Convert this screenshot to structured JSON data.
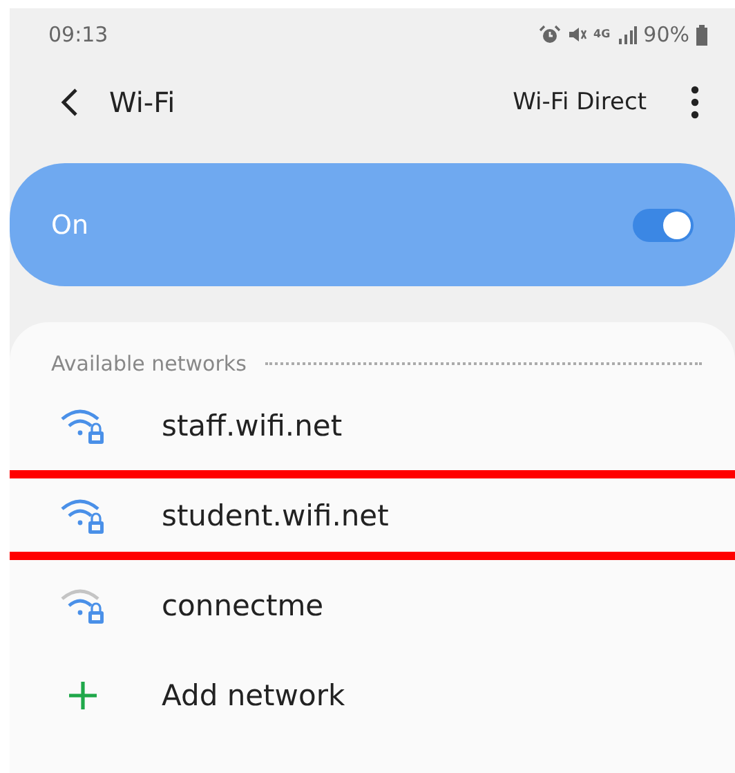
{
  "status_bar": {
    "time": "09:13",
    "network_type": "4G",
    "battery": "90%"
  },
  "header": {
    "title": "Wi-Fi",
    "action": "Wi-Fi Direct"
  },
  "master_switch": {
    "label": "On",
    "on": true
  },
  "section": {
    "title": "Available networks"
  },
  "items": [
    {
      "kind": "network",
      "name": "staff.wifi.net",
      "weak_signal": false,
      "highlighted": false
    },
    {
      "kind": "network",
      "name": "student.wifi.net",
      "weak_signal": false,
      "highlighted": true
    },
    {
      "kind": "network",
      "name": "connectme",
      "weak_signal": true,
      "highlighted": false
    },
    {
      "kind": "add",
      "name": "Add network"
    }
  ]
}
